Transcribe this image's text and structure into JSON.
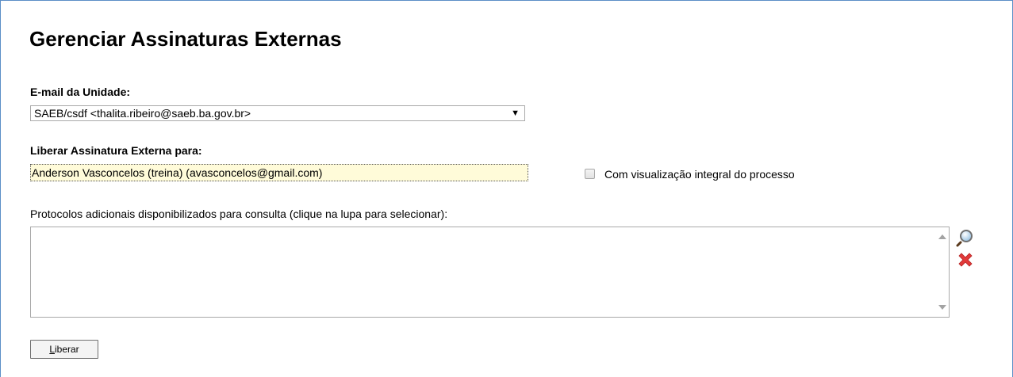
{
  "page": {
    "title": "Gerenciar Assinaturas Externas"
  },
  "email_unidade": {
    "label": "E-mail da Unidade:",
    "selected_value": "SAEB/csdf <thalita.ribeiro@saeb.ba.gov.br>",
    "arrow_icon": "dropdown-arrow-icon"
  },
  "liberar_para": {
    "label": "Liberar Assinatura Externa para:",
    "value": "Anderson Vasconcelos (treina) (avasconcelos@gmail.com)",
    "highlight_color": "#fffbd9"
  },
  "visualizacao": {
    "label": "Com visualização integral do processo",
    "checked": false
  },
  "protocolos": {
    "label": "Protocolos adicionais disponibilizados para consulta (clique na lupa para selecionar):",
    "items": [],
    "search_icon": "magnifier-icon",
    "remove_icon": "red-x-icon"
  },
  "actions": {
    "liberar_first": "L",
    "liberar_rest": "iberar"
  },
  "colors": {
    "frame_border": "#5b8ec7",
    "remove_red": "#e23a3a"
  }
}
